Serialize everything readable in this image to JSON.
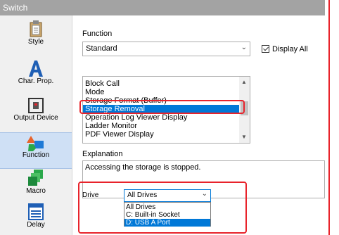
{
  "window": {
    "title": "Switch"
  },
  "sidebar": {
    "items": [
      {
        "label": "Style"
      },
      {
        "label": "Char. Prop."
      },
      {
        "label": "Output Device"
      },
      {
        "label": "Function"
      },
      {
        "label": "Macro"
      },
      {
        "label": "Delay"
      }
    ],
    "active": "Function"
  },
  "function": {
    "label": "Function",
    "selected": "Standard",
    "display_all_label": "Display All",
    "display_all_checked": true
  },
  "function_list": {
    "items": [
      "Block Call",
      "Mode",
      "Storage Format (Buffer)",
      "Storage Removal",
      "Operation Log Viewer Display",
      "Ladder Monitor",
      "PDF Viewer Display"
    ],
    "selected": "Storage Removal"
  },
  "explanation": {
    "label": "Explanation",
    "text": "Accessing the storage is stopped."
  },
  "drive": {
    "label": "Drive",
    "selected": "All Drives",
    "options": [
      "All Drives",
      "C: Built-in Socket",
      "D: USB A Port"
    ],
    "highlighted": "D: USB A Port"
  },
  "colors": {
    "accent": "#e8232b",
    "selection": "#0078d7",
    "titlebar": "#a3a3a3"
  }
}
